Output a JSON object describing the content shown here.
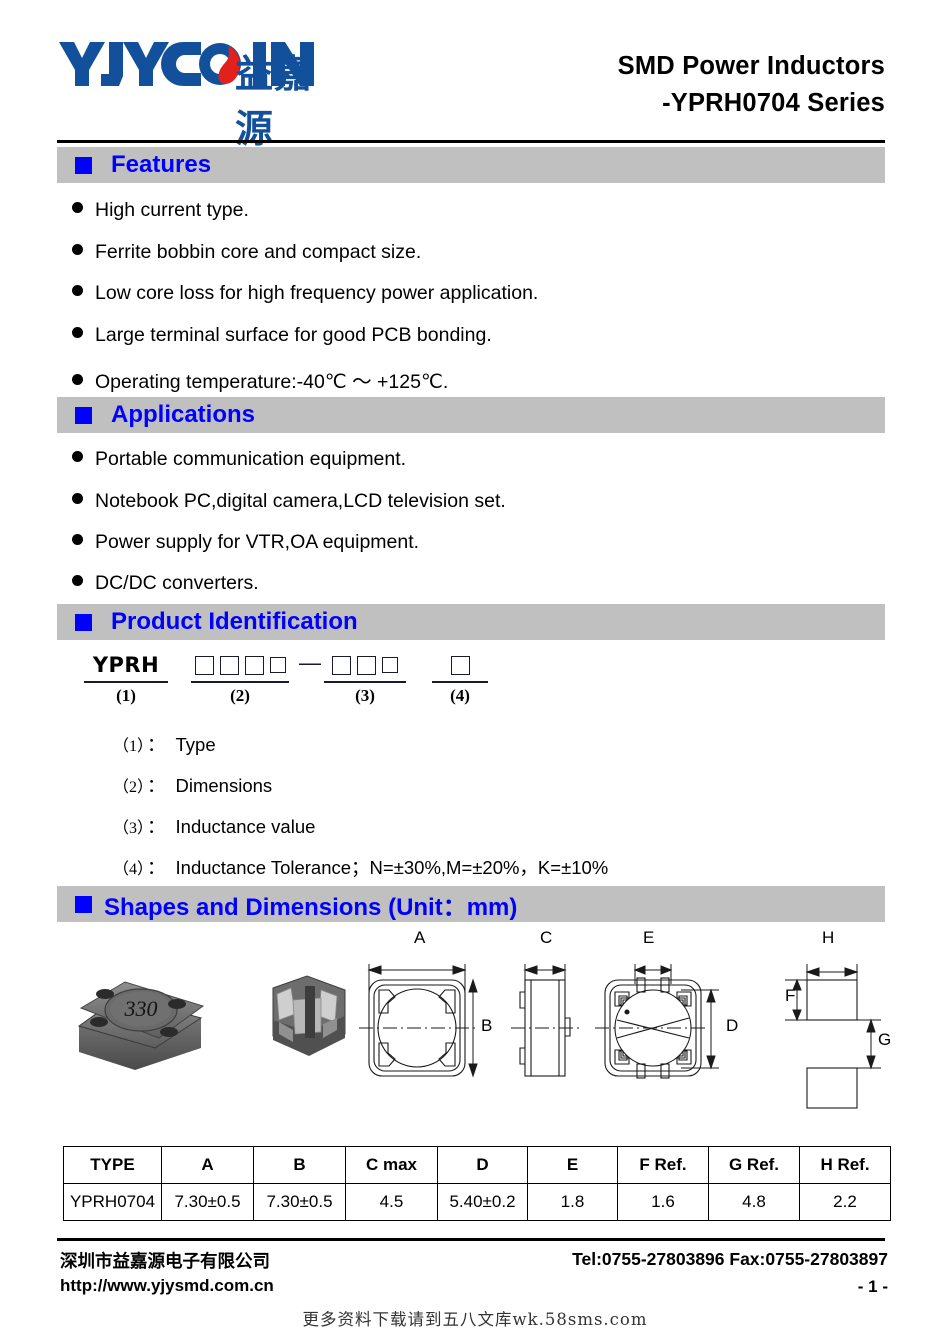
{
  "header": {
    "logo_latin": "YJYC IN",
    "logo_cn": "益嘉源",
    "title_line1": "SMD Power Inductors",
    "title_line2": "-YPRH0704 Series"
  },
  "sections": {
    "features": {
      "title": "Features",
      "items": [
        "High current type.",
        "Ferrite bobbin core and compact size.",
        "Low core loss for high frequency power application.",
        "Large terminal surface for good PCB bonding.",
        "Operating temperature:-40℃ ～ +125℃."
      ]
    },
    "applications": {
      "title": "Applications",
      "items": [
        "Portable communication equipment.",
        "Notebook PC,digital camera,LCD television set.",
        "Power supply for VTR,OA equipment.",
        "DC/DC converters."
      ]
    },
    "product_identification": {
      "title": "Product Identification",
      "part_prefix": "YPRH",
      "dash": "—",
      "group_labels": [
        "(1)",
        "(2)",
        "(3)",
        "(4)"
      ],
      "box_counts": [
        0,
        4,
        3,
        1
      ],
      "legend": [
        {
          "num": "（1）",
          "colon": "：",
          "text": "Type"
        },
        {
          "num": "（2）",
          "colon": "：",
          "text": "Dimensions"
        },
        {
          "num": "（3）",
          "colon": "：",
          "text": "Inductance value"
        },
        {
          "num": "（4）",
          "colon": "：",
          "text": "Inductance Tolerance；N=±30%,M=±20%，K=±10%"
        }
      ]
    },
    "shapes": {
      "title": "Shapes and Dimensions (Unit：mm)",
      "photo_marking": "330",
      "dimension_labels": [
        "A",
        "B",
        "C",
        "D",
        "E",
        "F",
        "G",
        "H"
      ]
    }
  },
  "spec_table": {
    "headers": [
      "TYPE",
      "A",
      "B",
      "C max",
      "D",
      "E",
      "F Ref.",
      "G Ref.",
      "H Ref."
    ],
    "rows": [
      [
        "YPRH0704",
        "7.30±0.5",
        "7.30±0.5",
        "4.5",
        "5.40±0.2",
        "1.8",
        "1.6",
        "4.8",
        "2.2"
      ]
    ]
  },
  "footer": {
    "company_cn": "深圳市益嘉源电子有限公司",
    "url": "http://www.yjysmd.com.cn",
    "tel_fax": "Tel:0755-27803896   Fax:0755-27803897",
    "page_number": "- 1 -",
    "watermark": "更多资料下载请到五八文库wk.58sms.com"
  },
  "colors": {
    "brand_blue": "#12509b",
    "accent_blue": "#0000ff",
    "section_bar": "#c0c0c0"
  }
}
